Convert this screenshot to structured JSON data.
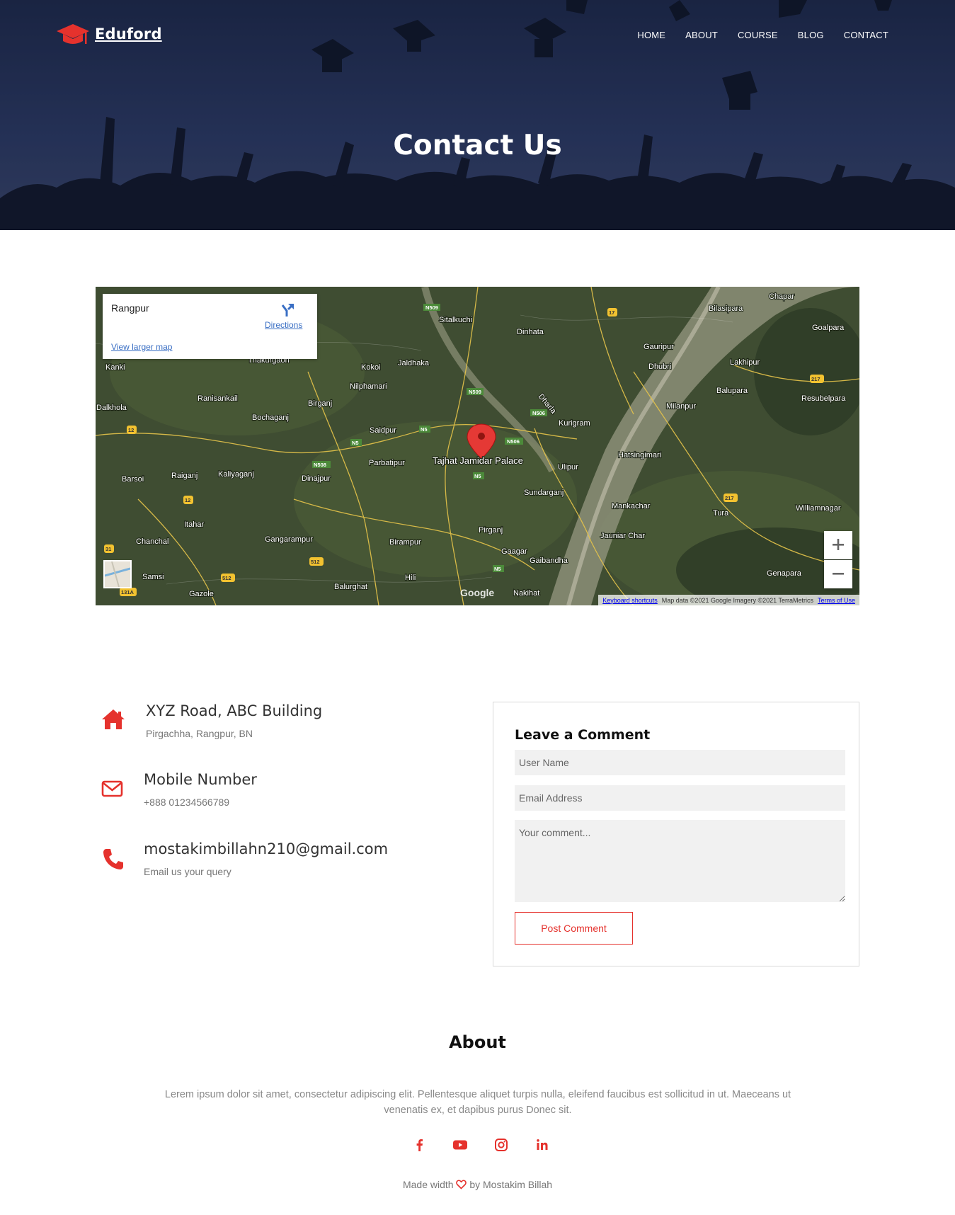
{
  "brand": {
    "name": "Eduford",
    "accent": "#e5322d"
  },
  "nav": {
    "items": [
      "HOME",
      "ABOUT",
      "COURSE",
      "BLOG",
      "CONTACT"
    ]
  },
  "hero": {
    "title": "Contact Us"
  },
  "map": {
    "place_name": "Rangpur",
    "directions_label": "Directions",
    "larger_map_label": "View larger map",
    "marker_label": "Tajhat Jamidar Palace",
    "footer": [
      "Keyboard shortcuts",
      "Map data ©2021 Google Imagery ©2021 TerraMetrics",
      "Terms of Use"
    ],
    "google_label": "Google",
    "places": [
      "Chapar",
      "Bilasipara",
      "Goalpara",
      "Sitalkuchi",
      "Dinhata",
      "Gauripur",
      "Dhubri",
      "Lakhipur",
      "Balupara",
      "Resubelpara",
      "Kokoi",
      "Jaldhaka",
      "Nilphamari",
      "Thakurgaon",
      "Kanki",
      "Dalkhola",
      "Ranisankail",
      "Birganj",
      "Bochaganj",
      "Saidpur",
      "Kurigram",
      "Milanpur",
      "Hatsingimari",
      "Barsoi",
      "Raiganj",
      "Kaliyaganj",
      "Dinajpur",
      "Parbatipur",
      "Ulipur",
      "Sundarganj",
      "Mankachar",
      "Tura",
      "Williamnagar",
      "Itahar",
      "Chanchal",
      "Gangarampur",
      "Birampur",
      "Pirganj",
      "Jauniar Char",
      "Gaagar",
      "Gaibandha",
      "Samsi",
      "Gazole",
      "Balurghat",
      "Hili",
      "Nakihat",
      "Genapara"
    ],
    "roads": [
      "N509",
      "N509",
      "N506",
      "N506",
      "N5",
      "N5",
      "N5",
      "N508",
      "N5",
      "17",
      "217",
      "217",
      "12",
      "12",
      "31",
      "512",
      "512",
      "131A"
    ],
    "river_label": "Dharla"
  },
  "contact": {
    "address_title": "XYZ Road, ABC Building",
    "address_sub": "Pirgachha, Rangpur, BN",
    "phone_title": "Mobile Number",
    "phone_sub": "+888 01234566789",
    "email_title": "mostakimbillahn210@gmail.com",
    "email_sub": "Email us your query"
  },
  "form": {
    "title": "Leave a Comment",
    "user_placeholder": "User Name",
    "email_placeholder": "Email Address",
    "comment_placeholder": "Your comment...",
    "submit_label": "Post Comment"
  },
  "about": {
    "title": "About",
    "text": "Lerem ipsum dolor sit amet, consectetur adipiscing elit. Pellentesque aliquet turpis nulla, eleifend faucibus est sollicitud in ut. Maeceans ut venenatis ex, et dapibus purus Donec sit.",
    "socials": [
      "facebook-icon",
      "youtube-icon",
      "instagram-icon",
      "linkedin-icon"
    ],
    "made_prefix": "Made width",
    "made_suffix": "by Mostakim Billah"
  }
}
